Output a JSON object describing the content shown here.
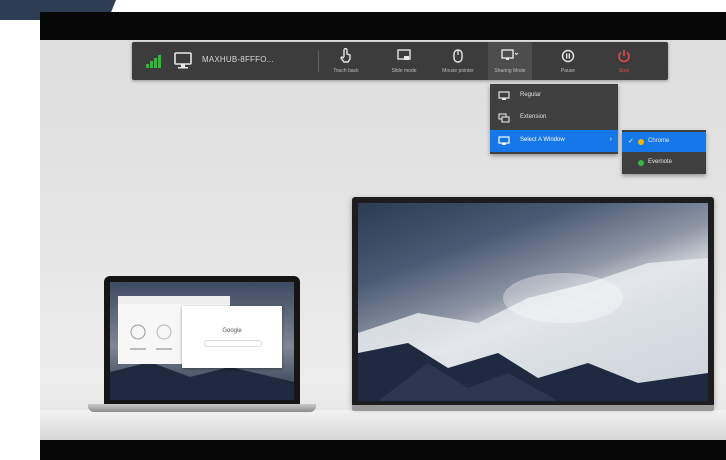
{
  "toolbar": {
    "device_name": "MAXHUB-8FFFO...",
    "buttons": [
      {
        "label": "Touch back",
        "icon": "touch-back-icon"
      },
      {
        "label": "Slide mode",
        "icon": "slide-mode-icon"
      },
      {
        "label": "Mouse pointer",
        "icon": "mouse-pointer-icon"
      },
      {
        "label": "Sharing Mode",
        "icon": "sharing-mode-icon"
      },
      {
        "label": "Pause",
        "icon": "pause-icon"
      },
      {
        "label": "Stop",
        "icon": "stop-icon"
      }
    ]
  },
  "sharing_menu": {
    "items": [
      {
        "label": "Regular",
        "icon": "monitor-icon"
      },
      {
        "label": "Extension",
        "icon": "extend-display-icon"
      },
      {
        "label": "Select A Window",
        "icon": "window-icon"
      }
    ],
    "selected_index": 2
  },
  "window_submenu": {
    "items": [
      {
        "label": "Chrome",
        "checked": true,
        "dot_color": "#f2b705"
      },
      {
        "label": "Evernote",
        "checked": false,
        "dot_color": "#3cb54a"
      }
    ]
  },
  "laptop_window": {
    "search_title": "Google"
  },
  "colors": {
    "accent": "#1677e8",
    "stop": "#e04a4a",
    "signal": "#3fae44"
  }
}
